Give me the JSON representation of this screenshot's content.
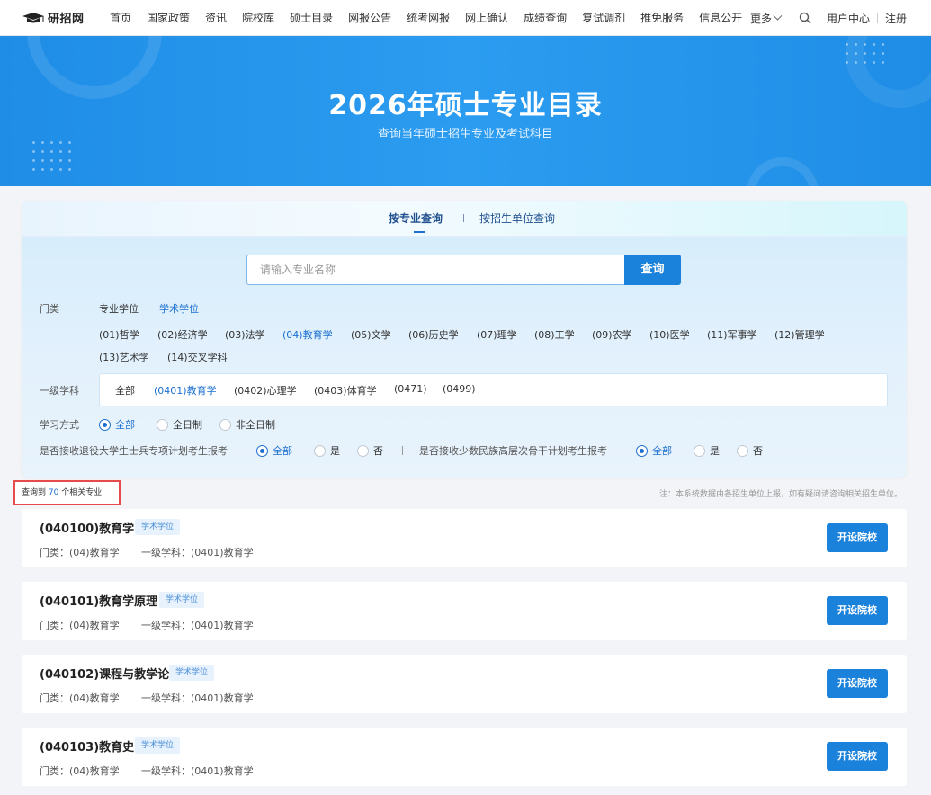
{
  "brand": {
    "name": "研招网"
  },
  "nav": {
    "items": [
      "首页",
      "国家政策",
      "资讯",
      "院校库",
      "硕士目录",
      "网报公告",
      "统考网报",
      "网上确认",
      "成绩查询",
      "复试调剂",
      "推免服务",
      "信息公开"
    ],
    "more": "更多",
    "user_center": "用户中心",
    "register": "注册"
  },
  "hero": {
    "title": "2026年硕士专业目录",
    "subtitle": "查询当年硕士招生专业及考试科目"
  },
  "tabs": {
    "by_major": "按专业查询",
    "by_unit": "按招生单位查询"
  },
  "search": {
    "placeholder": "请输入专业名称",
    "button": "查询"
  },
  "filters": {
    "category_label": "门类",
    "degree_types": [
      "专业学位",
      "学术学位"
    ],
    "categories": [
      "(01)哲学",
      "(02)经济学",
      "(03)法学",
      "(04)教育学",
      "(05)文学",
      "(06)历史学",
      "(07)理学",
      "(08)工学",
      "(09)农学",
      "(10)医学",
      "(11)军事学",
      "(12)管理学",
      "(13)艺术学",
      "(14)交叉学科"
    ],
    "subject_label": "一级学科",
    "subjects": [
      "全部",
      "(0401)教育学",
      "(0402)心理学",
      "(0403)体育学",
      "(0471)",
      "(0499)"
    ],
    "study_label": "学习方式",
    "study_options": [
      "全部",
      "全日制",
      "非全日制"
    ],
    "veteran_label": "是否接收退役大学生士兵专项计划考生报考",
    "minority_label": "是否接收少数民族高层次骨干计划考生报考",
    "yesno_options": [
      "全部",
      "是",
      "否"
    ]
  },
  "result": {
    "prefix": "查询到",
    "count": "70",
    "suffix": "个相关专业",
    "note": "注：本系统数据由各招生单位上报，如有疑问请咨询相关招生单位。"
  },
  "majors": [
    {
      "title": "(040100)教育学",
      "badge": "学术学位",
      "category": "门类：(04)教育学",
      "subject": "一级学科：(0401)教育学",
      "button": "开设院校"
    },
    {
      "title": "(040101)教育学原理",
      "badge": "学术学位",
      "category": "门类：(04)教育学",
      "subject": "一级学科：(0401)教育学",
      "button": "开设院校"
    },
    {
      "title": "(040102)课程与教学论",
      "badge": "学术学位",
      "category": "门类：(04)教育学",
      "subject": "一级学科：(0401)教育学",
      "button": "开设院校"
    },
    {
      "title": "(040103)教育史",
      "badge": "学术学位",
      "category": "门类：(04)教育学",
      "subject": "一级学科：(0401)教育学",
      "button": "开设院校"
    }
  ]
}
